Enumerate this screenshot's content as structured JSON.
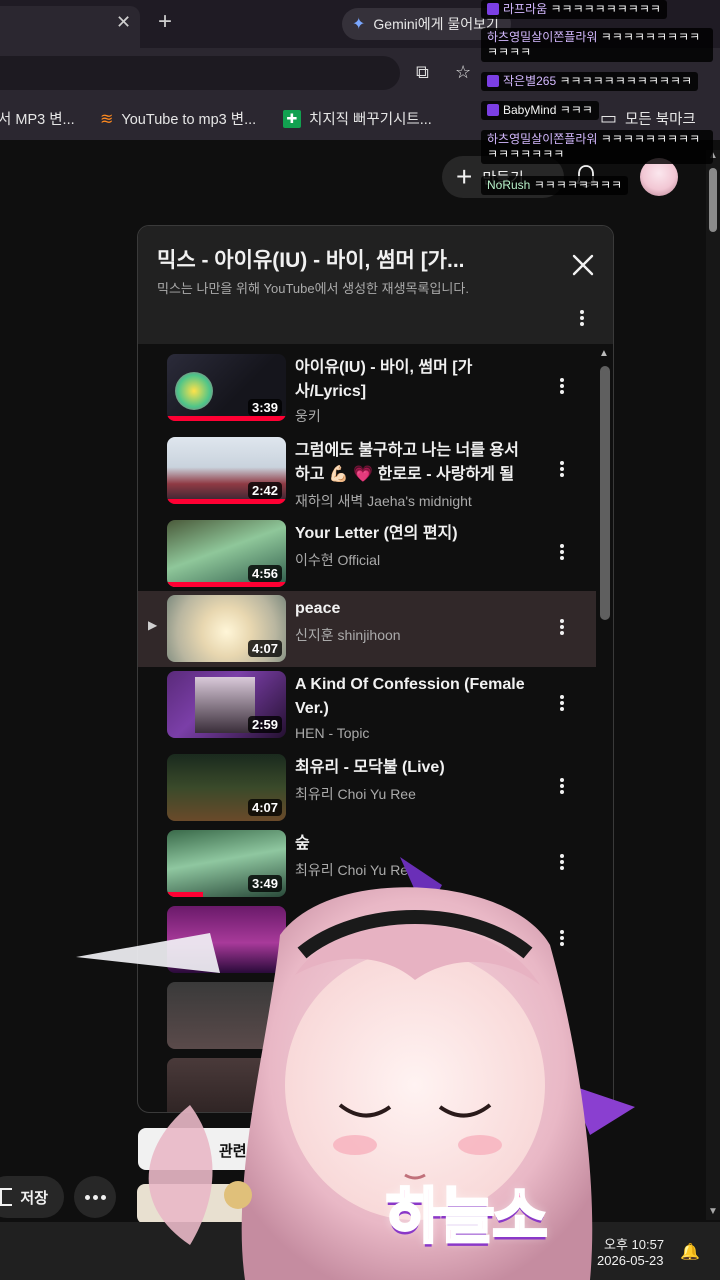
{
  "browser": {
    "tab_close_icon": "close-icon",
    "gemini_label": "Gemini에게 물어보기",
    "bookmarks": [
      {
        "label": "서 MP3 변..."
      },
      {
        "label": "YouTube to mp3 변..."
      },
      {
        "label": "치지직 뻐꾸기시트..."
      },
      {
        "label": "모든 북마크"
      }
    ]
  },
  "header": {
    "create_label": "만들기"
  },
  "panel": {
    "title": "믹스 - 아이유(IU) - 바이, 썸머 [가...",
    "subtitle": "믹스는 나만을 위해 YouTube에서 생성한 재생목록입니다.",
    "items": [
      {
        "title": "아이유(IU) - 바이, 썸머 [가사/Lyrics]",
        "channel": "웅키",
        "duration": "3:39",
        "progress": 1.0,
        "now_playing": false
      },
      {
        "title": "그럼에도 불구하고 나는 너를 용서하고 💪🏻 💗 한로로 - 사랑하게 될 거야",
        "channel": "재하의 새벽 Jaeha's midnight",
        "duration": "2:42",
        "progress": 1.0,
        "now_playing": false
      },
      {
        "title": "Your Letter (연의 편지)",
        "channel": "이수현 Official",
        "duration": "4:56",
        "progress": 1.0,
        "now_playing": false
      },
      {
        "title": "peace",
        "channel": "신지훈 shinjihoon",
        "duration": "4:07",
        "progress": 0,
        "now_playing": true
      },
      {
        "title": "A Kind Of Confession (Female Ver.)",
        "channel": "HEN - Topic",
        "duration": "2:59",
        "progress": 0,
        "now_playing": false
      },
      {
        "title": "최유리 - 모닥불 (Live)",
        "channel": "최유리 Choi Yu Ree",
        "duration": "4:07",
        "progress": 0,
        "now_playing": false
      },
      {
        "title": "숲",
        "channel": "최유리 Choi Yu Ree",
        "duration": "3:49",
        "progress": 0.3,
        "now_playing": false
      }
    ]
  },
  "bottom": {
    "save_label": "저장",
    "related_label": "관련"
  },
  "taskbar": {
    "time": "오후 10:57",
    "date": "2026-05-23"
  },
  "chat": [
    {
      "nick": "라프라움",
      "text": "ㅋㅋㅋㅋㅋㅋㅋㅋㅋㅋ"
    },
    {
      "nick": "하츠영밀살이쫀플라워",
      "text": "ㅋㅋㅋㅋㅋㅋㅋㅋㅋㅋㅋㅋㅋ"
    },
    {
      "nick": "작은별265",
      "text": "ㅋㅋㅋㅋㅋㅋㅋㅋㅋㅋㅋㅋ"
    },
    {
      "nick": "BabyMind",
      "text": "ㅋㅋㅋ"
    },
    {
      "nick": "하츠영밀살이쫀플라워",
      "text": "ㅋㅋㅋㅋㅋㅋㅋㅋㅋㅋㅋㅋㅋㅋㅋㅋ"
    },
    {
      "nick": "NoRush",
      "text": "ㅋㅋㅋㅋㅋㅋㅋㅋ"
    }
  ],
  "overlay": {
    "logo_text": "하늘소"
  },
  "colors": {
    "accent": "#ff0033",
    "now_playing_bg": "#312829",
    "panel_head_bg": "#212121"
  }
}
